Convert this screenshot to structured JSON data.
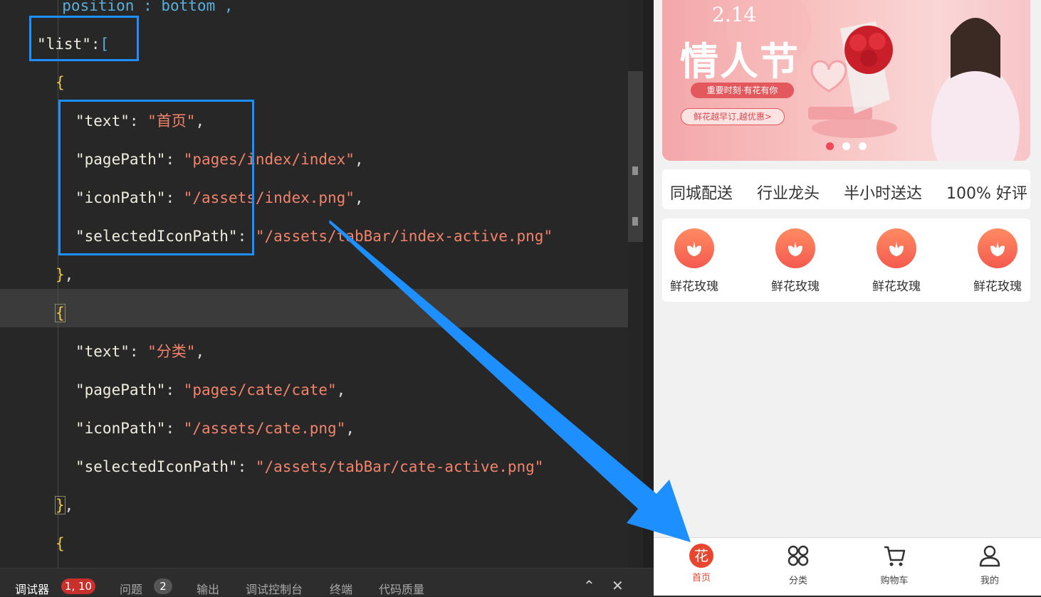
{
  "editor": {
    "lines": [
      {
        "parts": [
          {
            "c": "t",
            "v": "  position : bottom ,"
          }
        ]
      },
      {
        "parts": [
          {
            "c": "k",
            "v": "\"list\""
          },
          {
            "c": "p",
            "v": ":"
          },
          {
            "c": "t",
            "v": "["
          }
        ]
      },
      {
        "parts": [
          {
            "c": "b",
            "v": "{"
          }
        ]
      },
      {
        "parts": [
          {
            "c": "k",
            "v": "\"text\""
          },
          {
            "c": "p",
            "v": ": "
          },
          {
            "c": "s",
            "v": "\"首页\""
          },
          {
            "c": "p",
            "v": ","
          }
        ]
      },
      {
        "parts": [
          {
            "c": "k",
            "v": "\"pagePath\""
          },
          {
            "c": "p",
            "v": ": "
          },
          {
            "c": "s",
            "v": "\"pages/index/index\""
          },
          {
            "c": "p",
            "v": ","
          }
        ]
      },
      {
        "parts": [
          {
            "c": "k",
            "v": "\"iconPath\""
          },
          {
            "c": "p",
            "v": ": "
          },
          {
            "c": "s",
            "v": "\"/assets/index.png\""
          },
          {
            "c": "p",
            "v": ","
          }
        ]
      },
      {
        "parts": [
          {
            "c": "k",
            "v": "\"selectedIconPath\""
          },
          {
            "c": "p",
            "v": ": "
          },
          {
            "c": "s",
            "v": "\"/assets/tabBar/index-active.png\""
          }
        ]
      },
      {
        "parts": [
          {
            "c": "b",
            "v": "}"
          },
          {
            "c": "p",
            "v": ","
          }
        ]
      },
      {
        "parts": [
          {
            "c": "b",
            "v": "{"
          }
        ]
      },
      {
        "parts": [
          {
            "c": "k",
            "v": "\"text\""
          },
          {
            "c": "p",
            "v": ": "
          },
          {
            "c": "s",
            "v": "\"分类\""
          },
          {
            "c": "p",
            "v": ","
          }
        ]
      },
      {
        "parts": [
          {
            "c": "k",
            "v": "\"pagePath\""
          },
          {
            "c": "p",
            "v": ": "
          },
          {
            "c": "s",
            "v": "\"pages/cate/cate\""
          },
          {
            "c": "p",
            "v": ","
          }
        ]
      },
      {
        "parts": [
          {
            "c": "k",
            "v": "\"iconPath\""
          },
          {
            "c": "p",
            "v": ": "
          },
          {
            "c": "s",
            "v": "\"/assets/cate.png\""
          },
          {
            "c": "p",
            "v": ","
          }
        ]
      },
      {
        "parts": [
          {
            "c": "k",
            "v": "\"selectedIconPath\""
          },
          {
            "c": "p",
            "v": ": "
          },
          {
            "c": "s",
            "v": "\"/assets/tabBar/cate-active.png\""
          }
        ]
      },
      {
        "parts": [
          {
            "c": "b",
            "v": "}"
          },
          {
            "c": "p",
            "v": ","
          }
        ]
      },
      {
        "parts": [
          {
            "c": "b",
            "v": "{"
          }
        ]
      }
    ]
  },
  "panel": {
    "tabs": [
      "调试器",
      "问题",
      "输出",
      "调试控制台",
      "终端",
      "代码质量"
    ],
    "debugger_badge": "1, 10",
    "problems_badge": "2",
    "collapse_glyph": "⌃",
    "close_glyph": "✕"
  },
  "banner": {
    "date": "2.14",
    "title": "情人节",
    "tagline": "重要时刻·有花有你",
    "cta": "鲜花越早订,越优惠>"
  },
  "features": [
    "同城配送",
    "行业龙头",
    "半小时送达",
    "100% 好评"
  ],
  "categories": [
    "鲜花玫瑰",
    "鲜花玫瑰",
    "鲜花玫瑰",
    "鲜花玫瑰"
  ],
  "tabbar": {
    "items": [
      "首页",
      "分类",
      "购物车",
      "我的"
    ],
    "home_icon_glyph": "花"
  },
  "colors": {
    "accent": "#e8462e",
    "selection_box": "#1e8fff",
    "arrow": "#1e8fff"
  }
}
